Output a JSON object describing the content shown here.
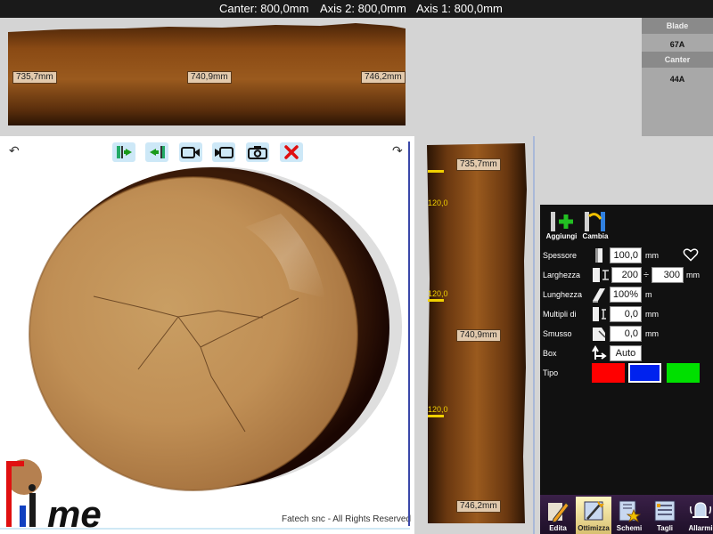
{
  "status": {
    "canter": "Canter: 800,0mm",
    "axis2": "Axis 2: 800,0mm",
    "axis1": "Axis 1: 800,0mm"
  },
  "top_log": {
    "measurements": [
      "735,7mm",
      "740,9mm",
      "746,2mm"
    ]
  },
  "blade_panel": {
    "blade_label": "Blade",
    "blade_value": "67A",
    "canter_label": "Canter",
    "canter_value": "44A"
  },
  "section_toolbar": {
    "icons": [
      "exit-left-icon",
      "enter-icon",
      "camera-video-icon",
      "video-icon",
      "photo-camera-icon",
      "close-icon"
    ]
  },
  "section": {
    "copyright": "Fatech snc - All Rights Reserved",
    "logo_text": "me"
  },
  "side_log": {
    "measurements": [
      "735,7mm",
      "740,9mm",
      "746,2mm"
    ],
    "markers": [
      "120,0",
      "120,0",
      "120,0"
    ]
  },
  "panel": {
    "add_label": "Aggiungi",
    "change_label": "Cambia",
    "spessore_label": "Spessore",
    "spessore_value": "100,0",
    "spessore_unit": "mm",
    "larghezza_label": "Larghezza",
    "larghezza_min": "200",
    "larghezza_sep": "÷",
    "larghezza_max": "300",
    "larghezza_unit": "mm",
    "lunghezza_label": "Lunghezza",
    "lunghezza_value": "100%",
    "lunghezza_unit": "m",
    "multipli_label": "Multipli di",
    "multipli_value": "0,0",
    "multipli_unit": "mm",
    "smusso_label": "Smusso",
    "smusso_value": "0,0",
    "smusso_unit": "mm",
    "box_label": "Box",
    "box_value": "Auto",
    "tipo_label": "Tipo",
    "tipo_colors": [
      "#ff0000",
      "#0022ee",
      "#00e000"
    ]
  },
  "bottom_toolbar": {
    "edita": "Edita",
    "ottimizza": "Ottimizza",
    "schemi": "Schemi",
    "tagli": "Tagli",
    "allarmi": "Allarmi"
  }
}
